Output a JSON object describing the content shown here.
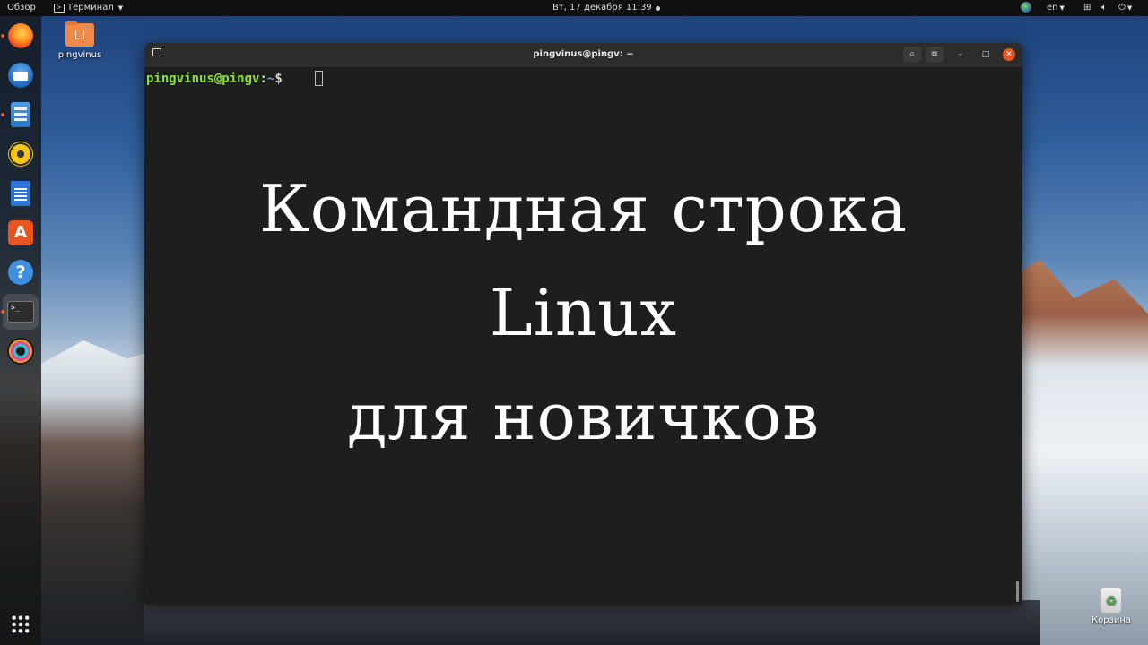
{
  "topbar": {
    "overview_label": "Обзор",
    "app_menu_label": "Терминал",
    "clock": "Вт, 17 декабря  11:39",
    "language": "en"
  },
  "dock": {
    "items": [
      {
        "name": "firefox",
        "running": true
      },
      {
        "name": "thunderbird-mail",
        "running": false
      },
      {
        "name": "files",
        "running": true
      },
      {
        "name": "rhythmbox",
        "running": false
      },
      {
        "name": "libreoffice-writer",
        "running": false
      },
      {
        "name": "ubuntu-software",
        "running": false
      },
      {
        "name": "help",
        "running": false
      },
      {
        "name": "terminal",
        "running": true,
        "active": true
      },
      {
        "name": "camera-app",
        "running": false
      }
    ],
    "show_apps_icon": "grid-icon"
  },
  "desktop": {
    "home_folder_label": "pingvinus",
    "trash_label": "Корзина"
  },
  "terminal": {
    "title": "pingvinus@pingv: ~",
    "prompt_user_host": "pingvinus@pingv",
    "prompt_colon": ":",
    "prompt_path": "~",
    "prompt_symbol": "$",
    "colors": {
      "user": "#8ae234",
      "path": "#729fcf",
      "background": "#1e1e1e",
      "close_button": "#e95420"
    }
  },
  "overlay": {
    "line1": "Командная строка",
    "line2": "Linux",
    "line3": "для новичков"
  }
}
